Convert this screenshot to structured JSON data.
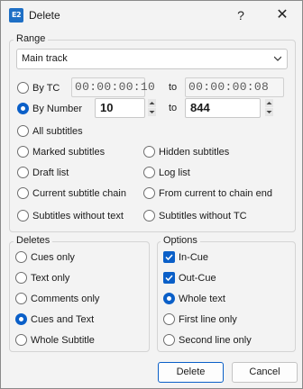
{
  "window": {
    "title": "Delete",
    "icon_text": "E2",
    "help_glyph": "?",
    "close_glyph": "✕"
  },
  "range": {
    "legend": "Range",
    "track_select": {
      "value": "Main track"
    },
    "by_tc": {
      "label": "By TC",
      "selected": false,
      "from": "00:00:00:10",
      "to_label": "to",
      "to": "00:00:00:08"
    },
    "by_number": {
      "label": "By Number",
      "selected": true,
      "from": "10",
      "to_label": "to",
      "to": "844"
    },
    "options": [
      {
        "label": "All subtitles",
        "selected": false
      },
      {
        "label": "Marked subtitles",
        "selected": false
      },
      {
        "label": "Hidden subtitles",
        "selected": false
      },
      {
        "label": "Draft list",
        "selected": false
      },
      {
        "label": "Log list",
        "selected": false
      },
      {
        "label": "Current subtitle chain",
        "selected": false
      },
      {
        "label": "From current to chain end",
        "selected": false
      },
      {
        "label": "Subtitles without text",
        "selected": false
      },
      {
        "label": "Subtitles without TC",
        "selected": false
      }
    ]
  },
  "deletes": {
    "legend": "Deletes",
    "items": [
      {
        "label": "Cues only",
        "selected": false
      },
      {
        "label": "Text only",
        "selected": false
      },
      {
        "label": "Comments only",
        "selected": false
      },
      {
        "label": "Cues and Text",
        "selected": true
      },
      {
        "label": "Whole Subtitle",
        "selected": false
      }
    ]
  },
  "options": {
    "legend": "Options",
    "in_cue": {
      "label": "In-Cue",
      "checked": true
    },
    "out_cue": {
      "label": "Out-Cue",
      "checked": true
    },
    "text_scope": [
      {
        "label": "Whole text",
        "selected": true
      },
      {
        "label": "First line only",
        "selected": false
      },
      {
        "label": "Second line only",
        "selected": false
      }
    ]
  },
  "buttons": {
    "delete": "Delete",
    "cancel": "Cancel"
  },
  "colors": {
    "accent": "#0a5fc8",
    "dialog_bg": "#f3f3f3",
    "border": "#d4d4d4"
  }
}
